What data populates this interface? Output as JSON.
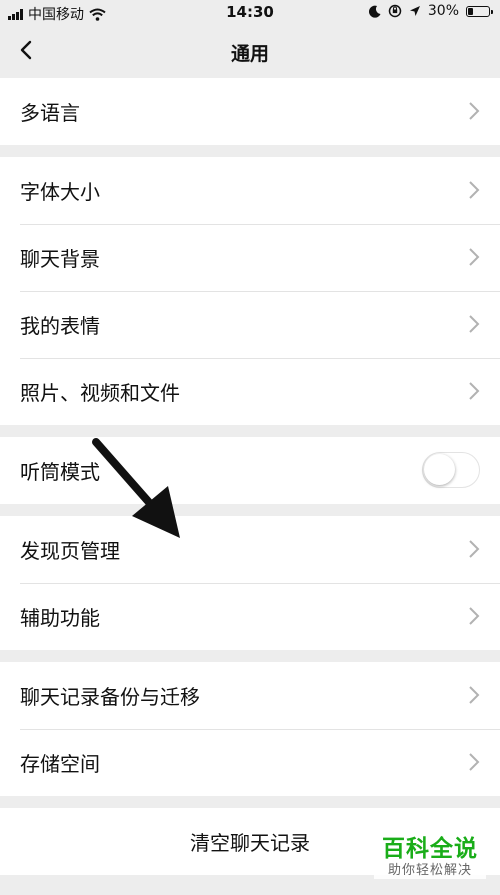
{
  "status_bar": {
    "carrier": "中国移动",
    "time": "14:30",
    "battery_percent": "30%",
    "battery_level": 0.3
  },
  "nav": {
    "title": "通用",
    "back_icon": "chevron-left-icon"
  },
  "groups": [
    {
      "items": [
        {
          "label": "多语言"
        }
      ]
    },
    {
      "items": [
        {
          "label": "字体大小"
        },
        {
          "label": "聊天背景"
        },
        {
          "label": "我的表情"
        },
        {
          "label": "照片、视频和文件"
        }
      ]
    },
    {
      "items": [
        {
          "label": "听筒模式",
          "toggle": false
        }
      ]
    },
    {
      "items": [
        {
          "label": "发现页管理"
        },
        {
          "label": "辅助功能"
        }
      ]
    },
    {
      "items": [
        {
          "label": "聊天记录备份与迁移"
        },
        {
          "label": "存储空间"
        }
      ]
    }
  ],
  "clear_button": {
    "label": "清空聊天记录"
  },
  "watermark": {
    "main": "百科全说",
    "sub": "助你轻松解决"
  },
  "colors": {
    "background": "#ededed",
    "row_bg": "#ffffff",
    "watermark_green": "#1aad19"
  }
}
